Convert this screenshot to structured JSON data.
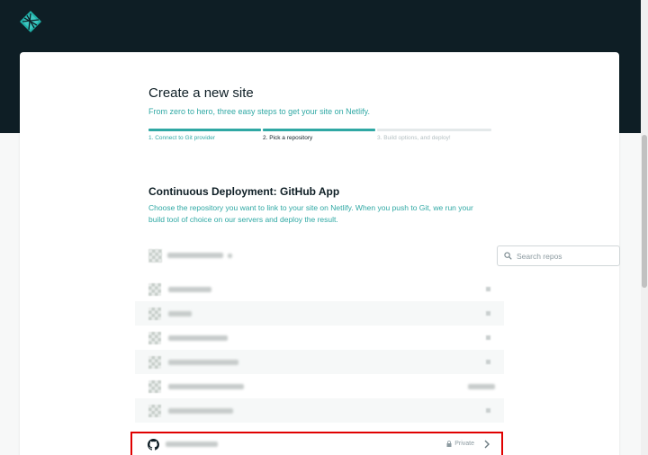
{
  "app": {
    "logo_icon": "netlify-logo-icon",
    "colors": {
      "topbar": "#0e1e25",
      "accent": "#2fa8a4",
      "step_inactive": "#e4e9ea",
      "highlight": "#e00000"
    }
  },
  "header": {
    "title": "Create a new site",
    "subtitle": "From zero to hero, three easy steps to get your site on Netlify."
  },
  "steps": [
    {
      "label": "1. Connect to Git provider",
      "state": "done"
    },
    {
      "label": "2. Pick a repository",
      "state": "current"
    },
    {
      "label": "3. Build options, and deploy!",
      "state": "todo"
    }
  ],
  "section": {
    "title": "Continuous Deployment: GitHub App",
    "description": "Choose the repository you want to link to your site on Netlify. When you push to Git, we run your build tool of choice on our servers and deploy the result."
  },
  "search": {
    "placeholder": "Search repos",
    "icon": "search-icon"
  },
  "highlighted_repo": {
    "visibility": "Private",
    "icon": "github-icon"
  }
}
